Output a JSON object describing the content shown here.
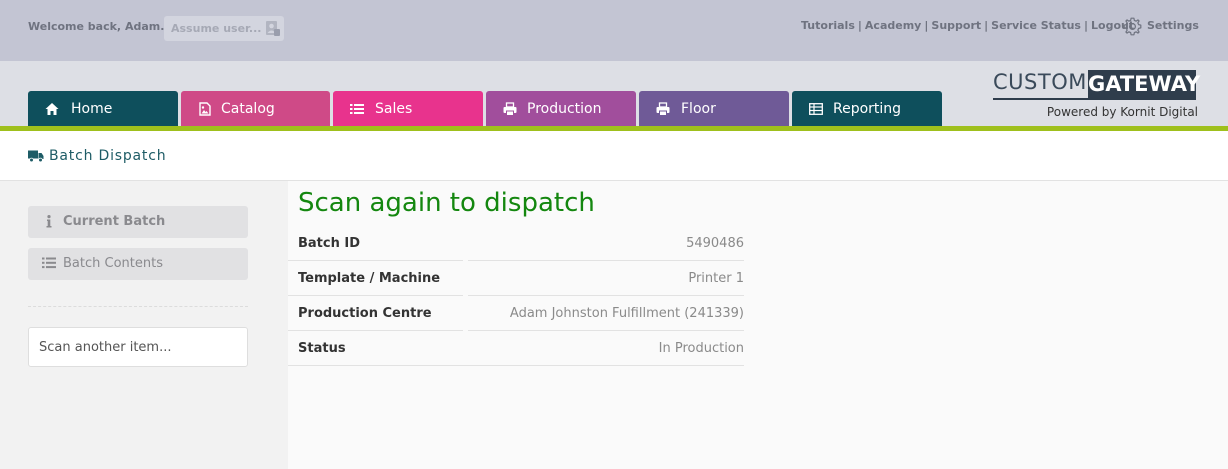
{
  "topbar": {
    "welcome": "Welcome back, Adam...",
    "assume_placeholder": "Assume user...",
    "links": [
      "Tutorials",
      "Academy",
      "Support",
      "Service Status",
      "Logout"
    ],
    "separator": "|",
    "settings_label": "Settings"
  },
  "nav": {
    "tabs": [
      {
        "label": "Home",
        "icon": "home-icon",
        "color": "#0e4f5c"
      },
      {
        "label": "Catalog",
        "icon": "image-icon",
        "color": "#cf4a87"
      },
      {
        "label": "Sales",
        "icon": "list-icon",
        "color": "#e8338d"
      },
      {
        "label": "Production",
        "icon": "printer-icon",
        "color": "#a14e9c"
      },
      {
        "label": "Floor",
        "icon": "printer-icon",
        "color": "#6f5a97"
      },
      {
        "label": "Reporting",
        "icon": "table-icon",
        "color": "#0e4f5c"
      }
    ]
  },
  "logo": {
    "custom": "CUSTOM",
    "gateway": "GATEWAY",
    "powered": "Powered by Kornit Digital"
  },
  "page": {
    "title": "Batch Dispatch",
    "title_icon": "truck-icon"
  },
  "sidebar": {
    "current_batch": "Current Batch",
    "batch_contents": "Batch Contents",
    "scan_placeholder": "Scan another item..."
  },
  "main": {
    "heading": "Scan again to dispatch",
    "details": [
      {
        "label": "Batch ID",
        "value": "5490486"
      },
      {
        "label": "Template / Machine",
        "value": "Printer 1"
      },
      {
        "label": "Production Centre",
        "value": "Adam Johnston Fulfillment (241339)"
      },
      {
        "label": "Status",
        "value": "In Production"
      }
    ]
  },
  "colors": {
    "accent_green_line": "#9fc01c",
    "heading_green": "#14870f",
    "title_teal": "#1e5c66"
  }
}
